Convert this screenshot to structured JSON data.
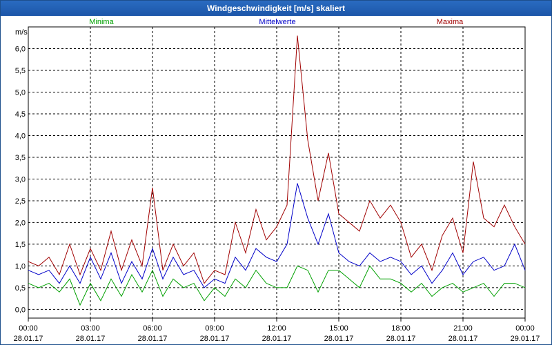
{
  "window": {
    "title": "Windgeschwindigkeit [m/s] skaliert"
  },
  "chart_data": {
    "type": "line",
    "title": "Windgeschwindigkeit [m/s] skaliert",
    "ylabel": "m/s",
    "ylim": [
      -0.2,
      6.5
    ],
    "xlim": [
      0,
      24
    ],
    "grid": true,
    "legend_placement": "top",
    "y_ticks": [
      "0,0",
      "0,5",
      "1,0",
      "1,5",
      "2,0",
      "2,5",
      "3,0",
      "3,5",
      "4,0",
      "4,5",
      "5,0",
      "5,5",
      "6,0"
    ],
    "y_tick_values": [
      0,
      0.5,
      1,
      1.5,
      2,
      2.5,
      3,
      3.5,
      4,
      4.5,
      5,
      5.5,
      6
    ],
    "x_ticks": [
      {
        "time": "00:00",
        "date": "28.01.17"
      },
      {
        "time": "03:00",
        "date": "28.01.17"
      },
      {
        "time": "06:00",
        "date": "28.01.17"
      },
      {
        "time": "09:00",
        "date": "28.01.17"
      },
      {
        "time": "12:00",
        "date": "28.01.17"
      },
      {
        "time": "15:00",
        "date": "28.01.17"
      },
      {
        "time": "18:00",
        "date": "28.01.17"
      },
      {
        "time": "21:00",
        "date": "28.01.17"
      },
      {
        "time": "00:00",
        "date": "29.01.17"
      }
    ],
    "x_tick_hours": [
      0,
      3,
      6,
      9,
      12,
      15,
      18,
      21,
      24
    ],
    "series": [
      {
        "name": "Minima",
        "color": "#00a000",
        "x": [
          0,
          0.5,
          1,
          1.5,
          2,
          2.5,
          3,
          3.5,
          4,
          4.5,
          5,
          5.5,
          6,
          6.5,
          7,
          7.5,
          8,
          8.5,
          9,
          9.5,
          10,
          10.5,
          11,
          11.5,
          12,
          12.5,
          13,
          13.5,
          14,
          14.5,
          15,
          15.5,
          16,
          16.5,
          17,
          17.5,
          18,
          18.5,
          19,
          19.5,
          20,
          20.5,
          21,
          21.5,
          22,
          22.5,
          23,
          23.5,
          24
        ],
        "values": [
          0.6,
          0.5,
          0.6,
          0.4,
          0.7,
          0.1,
          0.6,
          0.2,
          0.7,
          0.3,
          0.8,
          0.4,
          0.9,
          0.3,
          0.7,
          0.5,
          0.6,
          0.2,
          0.5,
          0.3,
          0.7,
          0.5,
          0.9,
          0.6,
          0.5,
          0.5,
          1.0,
          0.9,
          0.4,
          0.9,
          0.9,
          0.7,
          0.5,
          1.0,
          0.7,
          0.7,
          0.6,
          0.4,
          0.6,
          0.3,
          0.5,
          0.6,
          0.4,
          0.5,
          0.6,
          0.3,
          0.6,
          0.6,
          0.5
        ]
      },
      {
        "name": "Mittelwerte",
        "color": "#0000c8",
        "x": [
          0,
          0.5,
          1,
          1.5,
          2,
          2.5,
          3,
          3.5,
          4,
          4.5,
          5,
          5.5,
          6,
          6.5,
          7,
          7.5,
          8,
          8.5,
          9,
          9.5,
          10,
          10.5,
          11,
          11.5,
          12,
          12.5,
          13,
          13.5,
          14,
          14.5,
          15,
          15.5,
          16,
          16.5,
          17,
          17.5,
          18,
          18.5,
          19,
          19.5,
          20,
          20.5,
          21,
          21.5,
          22,
          22.5,
          23,
          23.5,
          24
        ],
        "values": [
          0.9,
          0.8,
          0.9,
          0.6,
          1.0,
          0.6,
          1.2,
          0.7,
          1.3,
          0.6,
          1.1,
          0.7,
          1.4,
          0.7,
          1.2,
          0.8,
          0.9,
          0.5,
          0.7,
          0.6,
          1.2,
          0.9,
          1.4,
          1.2,
          1.1,
          1.5,
          2.9,
          2.1,
          1.5,
          2.2,
          1.3,
          1.1,
          1.0,
          1.3,
          1.1,
          1.2,
          1.1,
          0.8,
          1.0,
          0.6,
          0.9,
          1.3,
          0.8,
          1.1,
          1.2,
          0.9,
          1.0,
          1.5,
          0.9
        ]
      },
      {
        "name": "Maxima",
        "color": "#a00000",
        "x": [
          0,
          0.5,
          1,
          1.5,
          2,
          2.5,
          3,
          3.5,
          4,
          4.5,
          5,
          5.5,
          6,
          6.5,
          7,
          7.5,
          8,
          8.5,
          9,
          9.5,
          10,
          10.5,
          11,
          11.5,
          12,
          12.5,
          13,
          13.5,
          14,
          14.5,
          15,
          15.5,
          16,
          16.5,
          17,
          17.5,
          18,
          18.5,
          19,
          19.5,
          20,
          20.5,
          21,
          21.5,
          22,
          22.5,
          23,
          23.5,
          24
        ],
        "values": [
          1.1,
          1.0,
          1.2,
          0.8,
          1.5,
          0.8,
          1.4,
          0.9,
          1.8,
          0.9,
          1.6,
          1.0,
          2.8,
          0.9,
          1.5,
          1.0,
          1.3,
          0.6,
          0.9,
          0.8,
          2.0,
          1.3,
          2.3,
          1.6,
          1.9,
          2.4,
          6.3,
          3.9,
          2.5,
          3.6,
          2.2,
          2.0,
          1.8,
          2.5,
          2.1,
          2.4,
          2.0,
          1.2,
          1.5,
          0.9,
          1.7,
          2.1,
          1.3,
          3.4,
          2.1,
          1.9,
          2.4,
          1.9,
          1.5
        ]
      }
    ]
  }
}
